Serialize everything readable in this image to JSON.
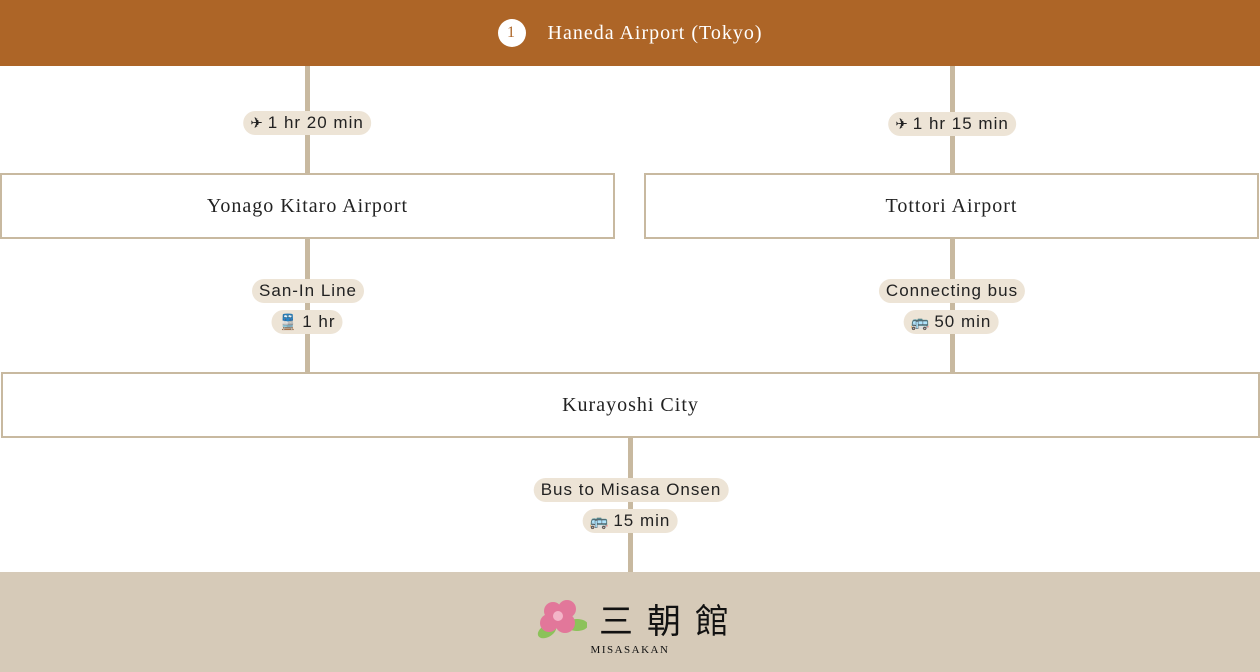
{
  "header": {
    "step": "1",
    "title": "Haneda Airport (Tokyo)"
  },
  "left": {
    "flight_time": "1 hr 20 min",
    "airport": "Yonago Kitaro Airport",
    "transfer_name": "San-In Line",
    "transfer_time": "1 hr"
  },
  "right": {
    "flight_time": "1 hr 15 min",
    "airport": "Tottori Airport",
    "transfer_name": "Connecting bus",
    "transfer_time": "50 min"
  },
  "city": {
    "name": "Kurayoshi City",
    "transfer_name": "Bus to Misasa Onsen",
    "transfer_time": "15 min"
  },
  "footer": {
    "logo_kanji": "三朝館",
    "logo_text": "MISASAKAN"
  },
  "colors": {
    "header": "#ad6527",
    "line": "#c8b9a0",
    "pill": "#ede4d6",
    "footer": "#d6cab8"
  },
  "icons": {
    "flight": "airplane-icon",
    "train": "train-icon",
    "bus": "bus-icon"
  }
}
